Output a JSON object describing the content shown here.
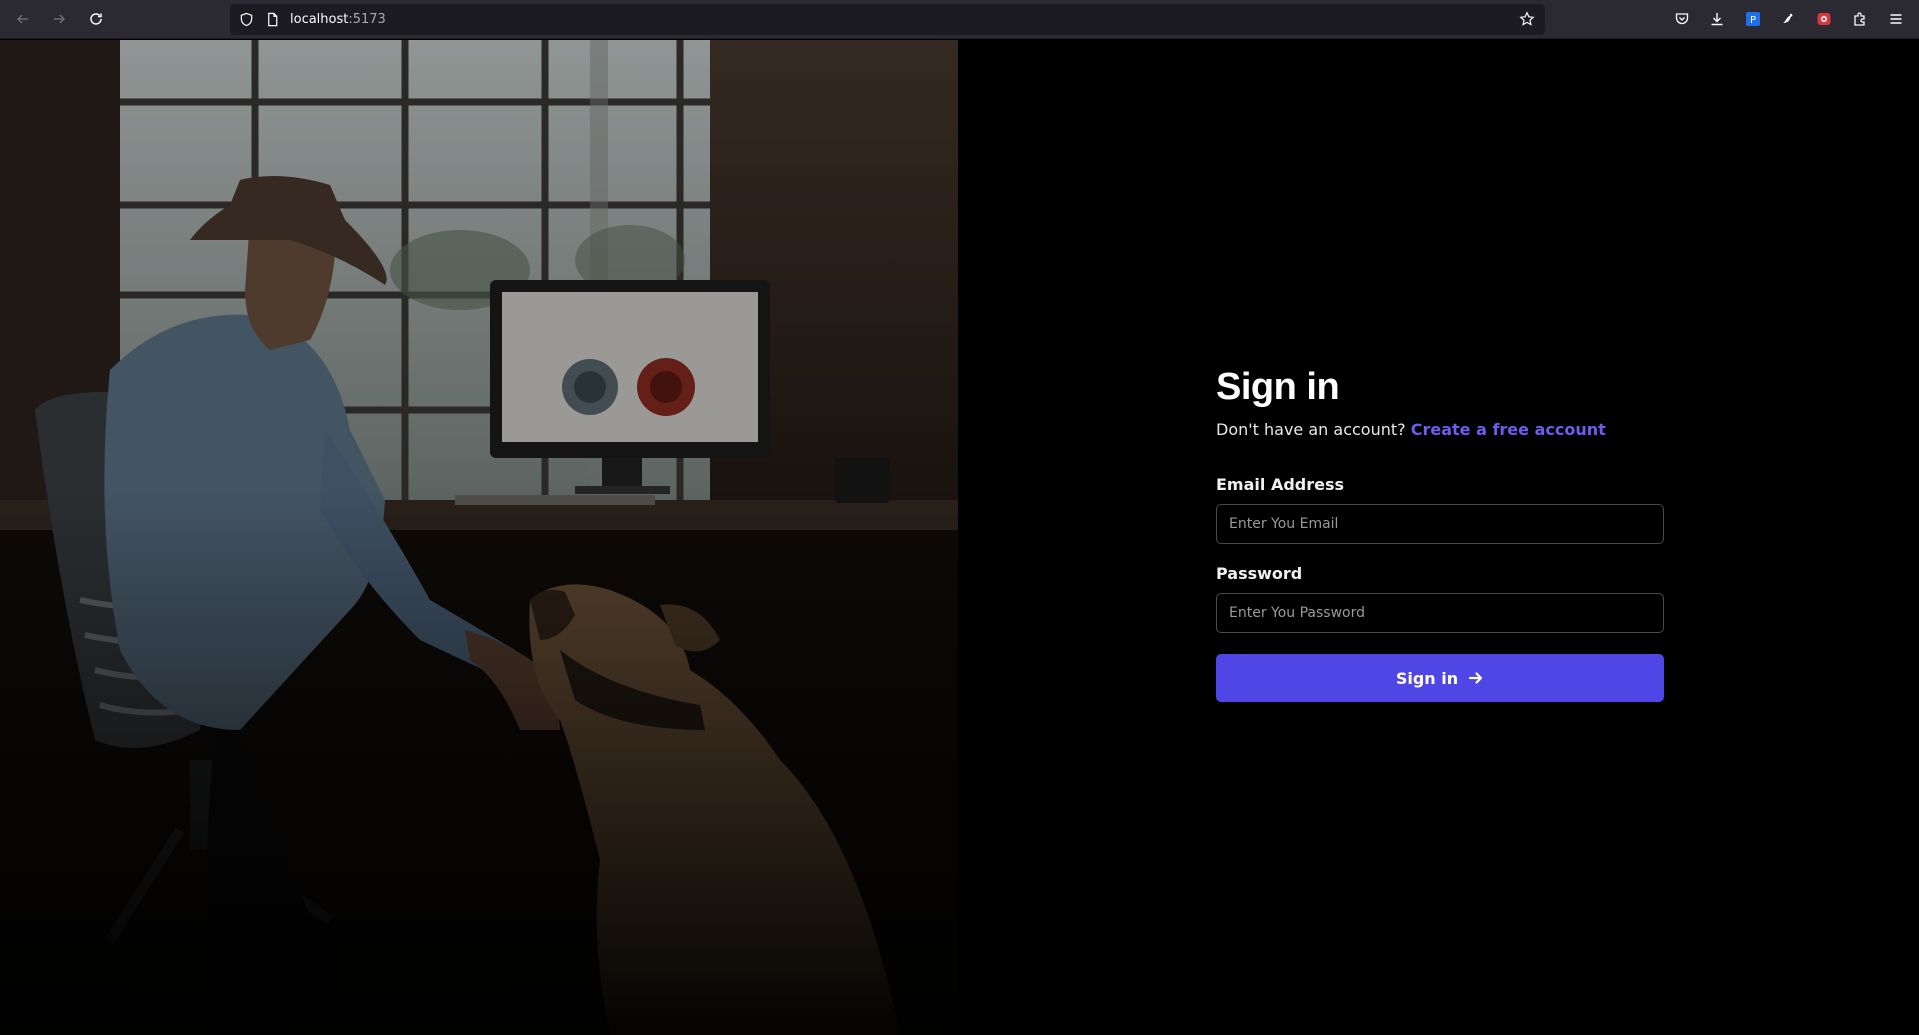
{
  "browser": {
    "url_host": "localhost",
    "url_port": ":5173",
    "icons": {
      "back": "arrow-left-icon",
      "forward": "arrow-right-icon",
      "reload": "reload-icon",
      "tracking": "shield-icon",
      "page": "page-icon",
      "bookmark": "star-icon",
      "pocket": "pocket-icon",
      "downloads": "download-icon",
      "ext1": "extension-p-icon",
      "ext2": "extension-bird-icon",
      "ext3": "extension-red-icon",
      "extensions": "puzzle-icon",
      "menu": "hamburger-menu-icon"
    }
  },
  "hero": {
    "image": "man-at-desk-with-dog-photo"
  },
  "signin": {
    "title": "Sign in",
    "subtitle_prefix": "Don't have an account?",
    "create_link": "Create a free account",
    "email_label": "Email Address",
    "email_placeholder": "Enter You Email",
    "email_value": "",
    "password_label": "Password",
    "password_placeholder": "Enter You Password",
    "password_value": "",
    "submit_label": "Sign in",
    "submit_icon": "arrow-right-icon"
  },
  "colors": {
    "accent": "#4f46e5",
    "link": "#6e5cf0",
    "background": "#000000"
  }
}
